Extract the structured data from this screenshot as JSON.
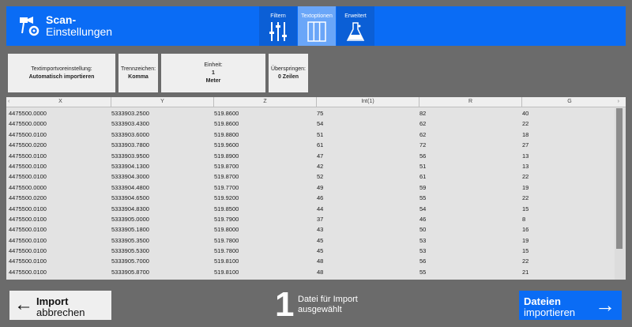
{
  "header": {
    "title_line1": "Scan-",
    "title_line2": "Einstellungen",
    "tabs": [
      {
        "label": "Filtern",
        "icon": "sliders-icon"
      },
      {
        "label": "Textoptionen",
        "icon": "columns-icon"
      },
      {
        "label": "Erweitert",
        "icon": "flask-icon"
      }
    ]
  },
  "options": {
    "preset": {
      "label": "Textimportvoreinstellung:",
      "value": "Automatisch importieren"
    },
    "separator": {
      "label": "Trennzeichen:",
      "value": "Komma"
    },
    "unit": {
      "label": "Einheit:",
      "value1": "1",
      "value2": "Meter"
    },
    "skip": {
      "label": "Überspringen:",
      "value": "0 Zeilen"
    }
  },
  "table": {
    "columns": [
      "X",
      "Y",
      "Z",
      "Int(1)",
      "R",
      "G"
    ],
    "rows": [
      [
        "4475500.0000",
        "5333903.2500",
        "519.8600",
        "75",
        "82",
        "40"
      ],
      [
        "4475500.0000",
        "5333903.4300",
        "519.8600",
        "54",
        "62",
        "22"
      ],
      [
        "4475500.0100",
        "5333903.6000",
        "519.8800",
        "51",
        "62",
        "18"
      ],
      [
        "4475500.0200",
        "5333903.7800",
        "519.9600",
        "61",
        "72",
        "27"
      ],
      [
        "4475500.0100",
        "5333903.9500",
        "519.8900",
        "47",
        "56",
        "13"
      ],
      [
        "4475500.0100",
        "5333904.1300",
        "519.8700",
        "42",
        "51",
        "13"
      ],
      [
        "4475500.0100",
        "5333904.3000",
        "519.8700",
        "52",
        "61",
        "22"
      ],
      [
        "4475500.0000",
        "5333904.4800",
        "519.7700",
        "49",
        "59",
        "19"
      ],
      [
        "4475500.0200",
        "5333904.6500",
        "519.9200",
        "46",
        "55",
        "22"
      ],
      [
        "4475500.0100",
        "5333904.8300",
        "519.8500",
        "44",
        "54",
        "15"
      ],
      [
        "4475500.0100",
        "5333905.0000",
        "519.7900",
        "37",
        "46",
        "8"
      ],
      [
        "4475500.0100",
        "5333905.1800",
        "519.8000",
        "43",
        "50",
        "16"
      ],
      [
        "4475500.0100",
        "5333905.3500",
        "519.7800",
        "45",
        "53",
        "19"
      ],
      [
        "4475500.0100",
        "5333905.5300",
        "519.7800",
        "45",
        "53",
        "15"
      ],
      [
        "4475500.0100",
        "5333905.7000",
        "519.8100",
        "48",
        "56",
        "22"
      ],
      [
        "4475500.0100",
        "5333905.8700",
        "519.8100",
        "48",
        "55",
        "21"
      ]
    ]
  },
  "footer": {
    "cancel_line1": "Import",
    "cancel_line2": "abbrechen",
    "file_count": "1",
    "count_line1": "Datei für Import",
    "count_line2": "ausgewählt",
    "import_line1": "Dateien",
    "import_line2": "importieren"
  },
  "colors": {
    "accent": "#0a6cf5",
    "background": "#6b6b6b"
  }
}
